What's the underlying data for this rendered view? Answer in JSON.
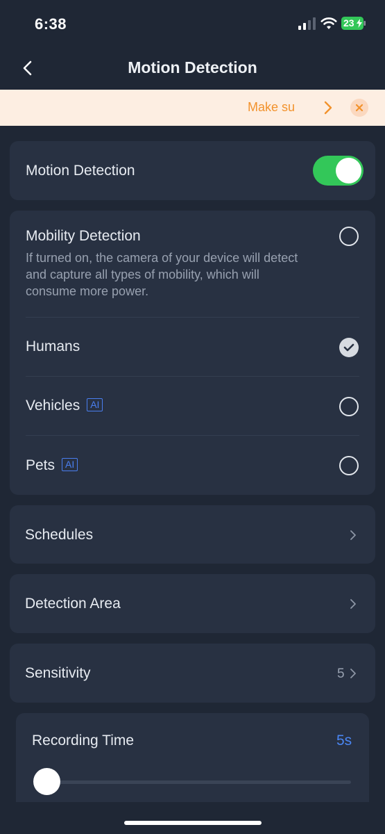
{
  "status_bar": {
    "time": "6:38",
    "battery": "23"
  },
  "nav": {
    "title": "Motion Detection"
  },
  "banner": {
    "text": "Make su"
  },
  "motion_detection": {
    "label": "Motion Detection",
    "enabled": true
  },
  "mobility": {
    "label": "Mobility Detection",
    "description": "If turned on, the camera of your device will detect and capture all types of mobility, which will consume more power.",
    "checked": false
  },
  "targets": [
    {
      "label": "Humans",
      "ai": false,
      "checked": true
    },
    {
      "label": "Vehicles",
      "ai": true,
      "ai_label": "AI",
      "checked": false
    },
    {
      "label": "Pets",
      "ai": true,
      "ai_label": "AI",
      "checked": false
    }
  ],
  "schedules": {
    "label": "Schedules"
  },
  "detection_area": {
    "label": "Detection Area"
  },
  "sensitivity": {
    "label": "Sensitivity",
    "value": "5"
  },
  "recording_time": {
    "label": "Recording Time",
    "value": "5s",
    "slider_fraction": 0.0
  },
  "colors": {
    "accent": "#4a86f3",
    "toggle_on": "#33c759",
    "banner_bg": "#fdeee2",
    "banner_text": "#f2922c",
    "card_bg": "#283142",
    "page_bg": "#1f2735"
  }
}
